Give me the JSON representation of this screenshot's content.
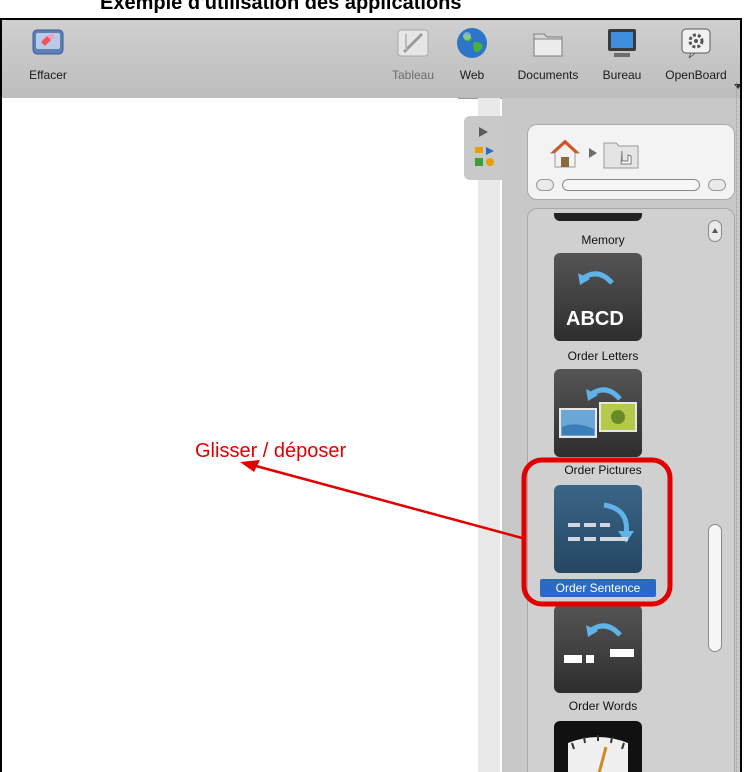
{
  "title": "Exemple d'utilisation des applications",
  "toolbar": {
    "effacer_label": "Effacer",
    "tableau_label": "Tableau",
    "web_label": "Web",
    "documents_label": "Documents",
    "bureau_label": "Bureau",
    "openboard_label": "OpenBoard"
  },
  "library": {
    "items": [
      {
        "label": "Memory"
      },
      {
        "label": "Order Letters",
        "thumb_text": "ABCD"
      },
      {
        "label": "Order Pictures"
      },
      {
        "label": "Order Sentence",
        "selected": true
      },
      {
        "label": "Order Words"
      },
      {
        "label": ""
      }
    ]
  },
  "annotation": {
    "text": "Glisser / déposer",
    "color": "#e00000"
  },
  "colors": {
    "toolbar": "#c5c5c5",
    "panel": "#c8c8c8",
    "selection": "#2a6ac6",
    "highlight": "#e00000"
  }
}
